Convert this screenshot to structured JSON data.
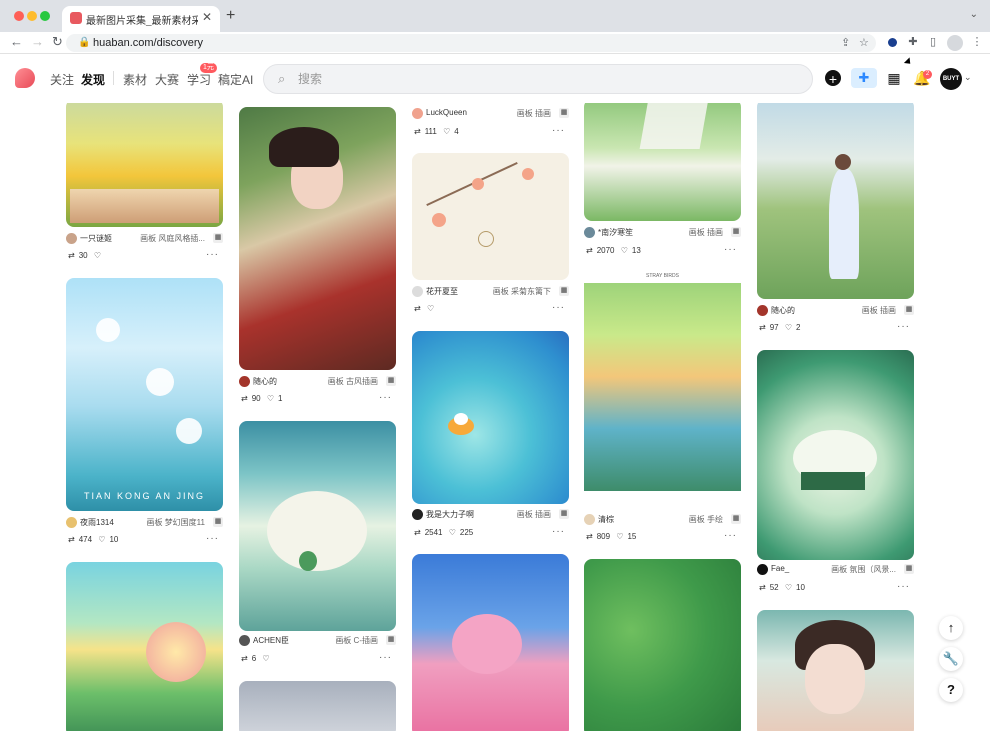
{
  "browser": {
    "tab_title": "最新图片采集_最新素材采集-花瓣",
    "tab_close": "✕",
    "new_tab": "+",
    "url": "huaban.com/discovery"
  },
  "header": {
    "nav": [
      "关注",
      "发现",
      "素材",
      "大赛",
      "学习",
      "稿定AI"
    ],
    "learn_badge": "1元",
    "search_placeholder": "搜索",
    "notif_count": "2",
    "avatar_text": "BUYT"
  },
  "columns": [
    {
      "cards": [
        {
          "author": "一只谜姬",
          "board_label": "画板",
          "board": "风庭风格插...",
          "saves": "30",
          "likes": "",
          "img": "sunflower"
        },
        {
          "author": "夜雨1314",
          "board_label": "画板",
          "board": "梦幻国度11",
          "saves": "474",
          "likes": "10",
          "img": "tulip",
          "caption": "TIAN KONG AN JING"
        },
        {
          "author": "",
          "board_label": "",
          "board": "",
          "saves": "",
          "likes": "",
          "img": "city"
        }
      ]
    },
    {
      "cards": [
        {
          "author": "随心的",
          "board_label": "画板",
          "board": "古风插画",
          "saves": "90",
          "likes": "1",
          "img": "redgirl"
        },
        {
          "author": "ACHEN臣",
          "board_label": "画板",
          "board": "C-插画",
          "saves": "6",
          "likes": "",
          "img": "cloudisland"
        },
        {
          "author": "",
          "board_label": "",
          "board": "",
          "saves": "",
          "likes": "",
          "img": "branch"
        }
      ]
    },
    {
      "cards": [
        {
          "author": "LuckQueen",
          "board_label": "画板",
          "board": "插画",
          "saves": "111",
          "likes": "4",
          "img": "none"
        },
        {
          "author": "花开夏至",
          "board_label": "画板",
          "board": "采菊东篱下",
          "saves": "",
          "likes": "",
          "img": "blossom"
        },
        {
          "author": "我是大力子啊",
          "board_label": "画板",
          "board": "插画",
          "saves": "2541",
          "likes": "225",
          "img": "pond"
        },
        {
          "author": "",
          "board_label": "",
          "board": "",
          "saves": "",
          "likes": "",
          "img": "pinkflower"
        }
      ]
    },
    {
      "cards": [
        {
          "author": "*南汐寒笙",
          "board_label": "画板",
          "board": "插画",
          "saves": "2070",
          "likes": "13",
          "img": "meadow"
        },
        {
          "author": "清棕",
          "board_label": "画板",
          "board": "手绘",
          "saves": "809",
          "likes": "15",
          "img": "stray",
          "caption": "STRAY BIRDS"
        },
        {
          "author": "",
          "board_label": "",
          "board": "",
          "saves": "",
          "likes": "",
          "img": "leaves"
        }
      ]
    },
    {
      "cards": [
        {
          "author": "随心的",
          "board_label": "画板",
          "board": "插画",
          "saves": "97",
          "likes": "2",
          "img": "hillgirl"
        },
        {
          "author": "Fae_",
          "board_label": "画板",
          "board": "氛围（风景...",
          "saves": "52",
          "likes": "10",
          "img": "cloudhouse"
        },
        {
          "author": "",
          "board_label": "",
          "board": "",
          "saves": "",
          "likes": "",
          "img": "portrait"
        }
      ]
    }
  ],
  "float_buttons": [
    "↑",
    "🔧",
    "?"
  ],
  "icons": {
    "save": "⇄",
    "like": "♡",
    "more": "···",
    "board": "▦"
  }
}
